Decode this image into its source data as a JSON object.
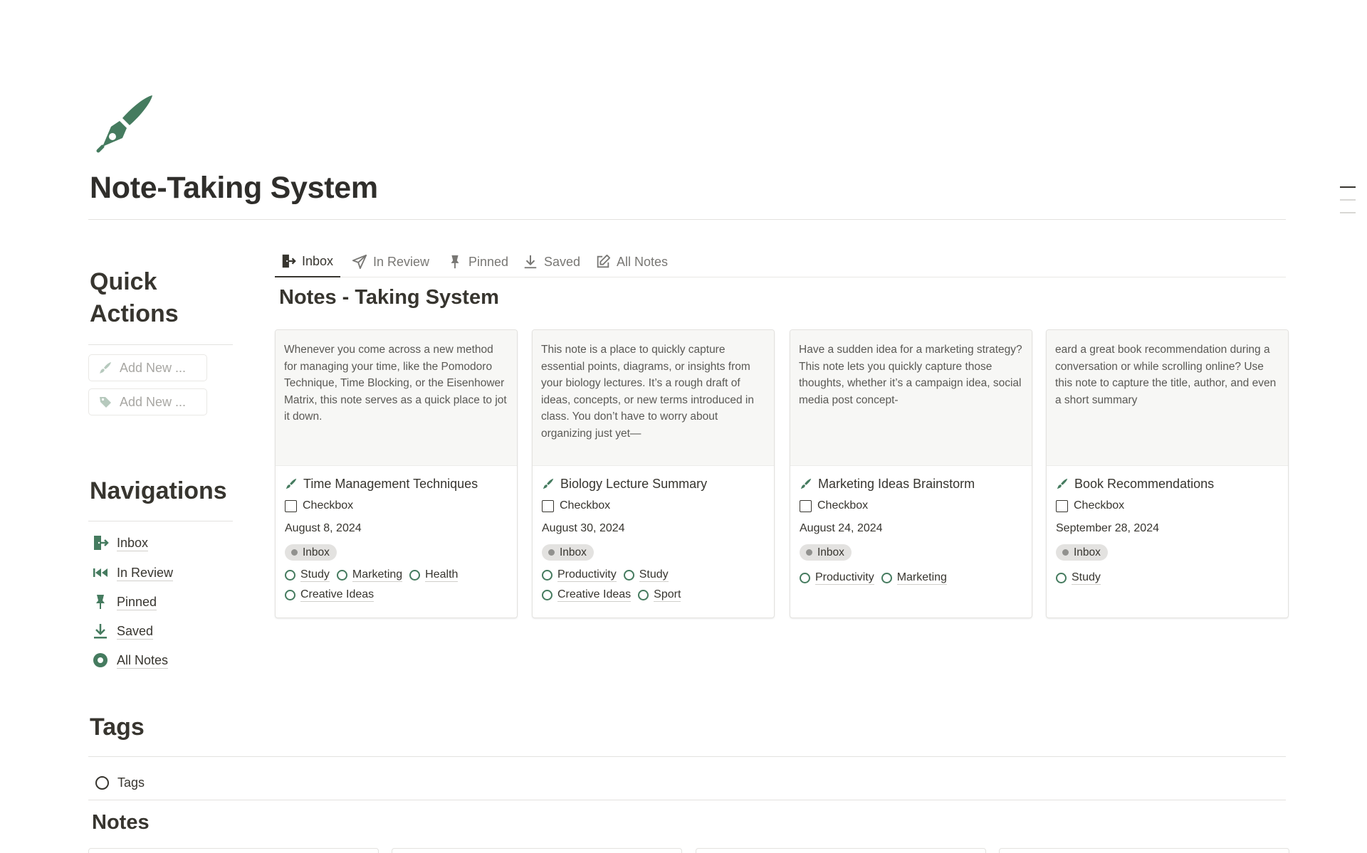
{
  "page": {
    "title": "Note-Taking System",
    "accent": "#457b5f"
  },
  "sidebar": {
    "quick_actions": {
      "heading_line1": "Quick",
      "heading_line2": "Actions",
      "buttons": [
        {
          "label": "Add New ...",
          "icon": "pen-icon"
        },
        {
          "label": "Add New ...",
          "icon": "tag-icon"
        }
      ]
    },
    "navigations": {
      "heading": "Navigations",
      "items": [
        {
          "label": "Inbox",
          "icon": "door-exit-icon"
        },
        {
          "label": "In Review",
          "icon": "rewind-icon"
        },
        {
          "label": "Pinned",
          "icon": "pin-icon"
        },
        {
          "label": "Saved",
          "icon": "download-icon"
        },
        {
          "label": "All Notes",
          "icon": "record-circle-icon"
        }
      ]
    },
    "tags": {
      "heading": "Tags",
      "link": "Tags"
    },
    "notes": {
      "heading": "Notes"
    }
  },
  "tabs": [
    {
      "label": "Inbox",
      "icon": "door-exit-icon",
      "active": true
    },
    {
      "label": "In Review",
      "icon": "paper-plane-icon",
      "active": false
    },
    {
      "label": "Pinned",
      "icon": "pin-icon",
      "active": false
    },
    {
      "label": "Saved",
      "icon": "download-icon",
      "active": false
    },
    {
      "label": "All Notes",
      "icon": "edit-icon",
      "active": false
    }
  ],
  "database": {
    "title": "Notes - Taking System",
    "cards": [
      {
        "preview": "Whenever you come across a new method for managing your time, like the Pomodoro Technique, Time Blocking, or the Eisenhower Matrix, this note serves as a quick place to jot it down.",
        "title": "Time Management Techniques",
        "checkbox": "Checkbox",
        "date": "August 8, 2024",
        "status": "Inbox",
        "tags": [
          "Study",
          "Marketing",
          "Health",
          "Creative Ideas"
        ]
      },
      {
        "preview": "This note is a place to quickly capture essential points, diagrams, or insights from your biology lectures. It’s a rough draft of ideas, concepts, or new terms introduced in class. You don’t have to worry about organizing just yet—",
        "title": "Biology Lecture Summary",
        "checkbox": "Checkbox",
        "date": "August 30, 2024",
        "status": "Inbox",
        "tags": [
          "Productivity",
          "Study",
          "Creative Ideas",
          "Sport"
        ]
      },
      {
        "preview": "Have a sudden idea for a marketing strategy? This note lets you quickly capture those thoughts, whether it’s a campaign idea, social media post concept-",
        "title": "Marketing Ideas Brainstorm",
        "checkbox": "Checkbox",
        "date": "August 24, 2024",
        "status": "Inbox",
        "tags": [
          "Productivity",
          "Marketing"
        ]
      },
      {
        "preview": "eard a great book recommendation during a conversation or while scrolling online? Use this note to capture the title, author, and even a short summary",
        "title": "Book Recommendations",
        "checkbox": "Checkbox",
        "date": "September 28, 2024",
        "status": "Inbox",
        "tags": [
          "Study"
        ]
      }
    ]
  }
}
